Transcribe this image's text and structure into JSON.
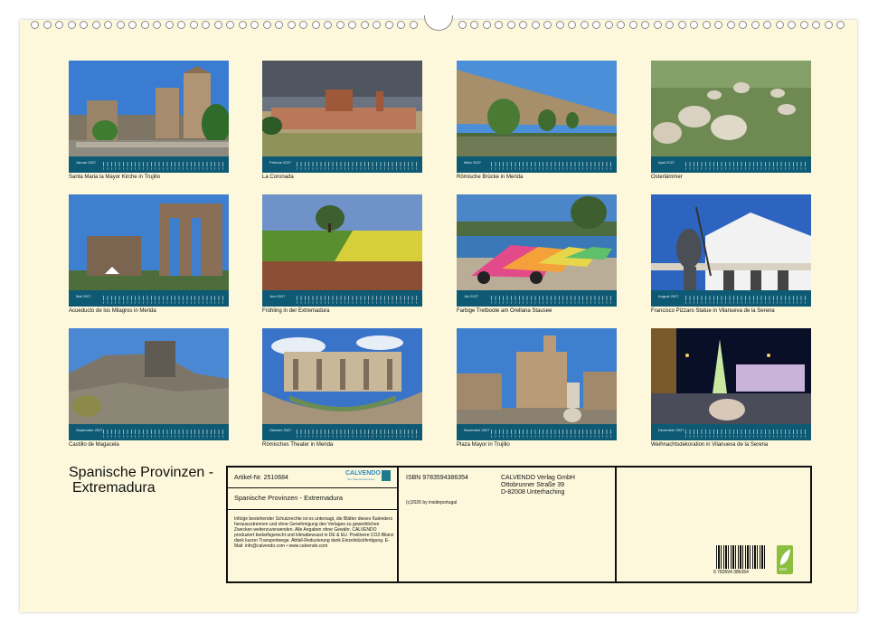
{
  "months": [
    {
      "name": "Januar 2027",
      "caption": "Santa Maria la Mayor Kirche in Trujillo"
    },
    {
      "name": "Februar 2027",
      "caption": "La Coronada"
    },
    {
      "name": "März 2027",
      "caption": "Römische Brücke in Merida"
    },
    {
      "name": "April 2027",
      "caption": "Osterlämmer"
    },
    {
      "name": "Mai 2027",
      "caption": "Acueducto de los Milagros in Merida"
    },
    {
      "name": "Juni 2027",
      "caption": "Frühling in der Extremadura"
    },
    {
      "name": "Juli 2027",
      "caption": "Farbige Tretboote am Orellana Stausee"
    },
    {
      "name": "August 2027",
      "caption": "Francisco Pizzaro Statue in Vilanueva de la Serena"
    },
    {
      "name": "September 2027",
      "caption": "Castillo de Magacela"
    },
    {
      "name": "Oktober 2027",
      "caption": "Römisches Theater in Merida"
    },
    {
      "name": "November 2027",
      "caption": "Plaza Mayor in Trujillo"
    },
    {
      "name": "Dezember 2027",
      "caption": "Weihnachtsdekoration in Vilanueva de la Serena"
    }
  ],
  "title": {
    "line1": "Spanische Provinzen -",
    "line2": "Extremadura"
  },
  "panel": {
    "article": "Artikel-Nr. 2510684",
    "logo_text": "CALVENDO",
    "logo_sub": "Ihre Kalenderdruckerei",
    "product_title": "Spanische Provinzen - Extremadura",
    "legal": "Infolge bestehender Schutzrechte ist es untersagt, die Blätter dieses Kalenders herauszutrennen und ohne Genehmigung des Verlages zu gewerblichen Zwecken weiterzuverwenden. Alle Angaben ohne Gewähr. CALVENDO produziert bedarfsgerecht und klimabewusst in DE & EU. Positivere CO2-Bilanz dank kurzer Transportwege. Abfall-Reduzierung dank Einzelstückfertigung. E-Mail: info@calvendo.com • www.calvendo.com",
    "isbn": "ISBN 9783594386354",
    "copyright": "(c)2026 by insideportugal",
    "publisher1": "CALVENDO Verlag GmbH",
    "publisher2": "Ottobrunner Straße 39",
    "publisher3": "D-82008 Unterhaching",
    "barcode_number": "9 783594 386354",
    "eco_label": "eco"
  },
  "colors": {
    "sheet": "#fdf8dc",
    "calendar_bar": "#0e5a74",
    "eco": "#8cbf3f"
  }
}
